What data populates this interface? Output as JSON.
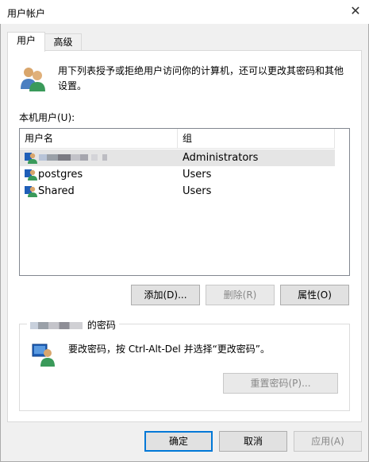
{
  "window": {
    "title": "用户帐户"
  },
  "tabs": [
    {
      "label": "用户",
      "active": true
    },
    {
      "label": "高级",
      "active": false
    }
  ],
  "intro": {
    "text": "用下列表授予或拒绝用户访问你的计算机，还可以更改其密码和其他设置。"
  },
  "users_section": {
    "label": "本机用户(U):",
    "columns": [
      "用户名",
      "组"
    ],
    "rows": [
      {
        "name": "",
        "group": "Administrators",
        "selected": true,
        "name_obscured": true
      },
      {
        "name": "postgres",
        "group": "Users",
        "selected": false
      },
      {
        "name": "Shared",
        "group": "Users",
        "selected": false
      }
    ]
  },
  "user_buttons": {
    "add": "添加(D)...",
    "remove": "删除(R)",
    "properties": "属性(O)"
  },
  "password_section": {
    "legend_suffix": "的密码",
    "text": "要改密码，按 Ctrl-Alt-Del 并选择“更改密码”。",
    "reset_button": "重置密码(P)..."
  },
  "dialog_buttons": {
    "ok": "确定",
    "cancel": "取消",
    "apply": "应用(A)"
  },
  "colors": {
    "focus_border": "#0078d7",
    "selection": "#e5e5e5"
  }
}
